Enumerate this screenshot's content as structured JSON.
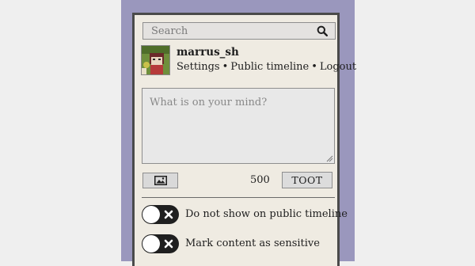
{
  "search": {
    "placeholder": "Search",
    "icon": "search-icon"
  },
  "account": {
    "username": "marrus_sh",
    "links": [
      "Settings",
      "Public timeline",
      "Logout"
    ],
    "separator": "•"
  },
  "compose": {
    "placeholder": "What is on your mind?",
    "char_count": "500",
    "submit_label": "TOOT",
    "media_icon": "image-icon"
  },
  "options": [
    {
      "label": "Do not show on public timeline",
      "enabled": false
    },
    {
      "label": "Mark content as sensitive",
      "enabled": false
    }
  ],
  "colors": {
    "sidebar": "#9a97bd",
    "panel": "#efebe2",
    "toggle": "#1f1f1f"
  }
}
